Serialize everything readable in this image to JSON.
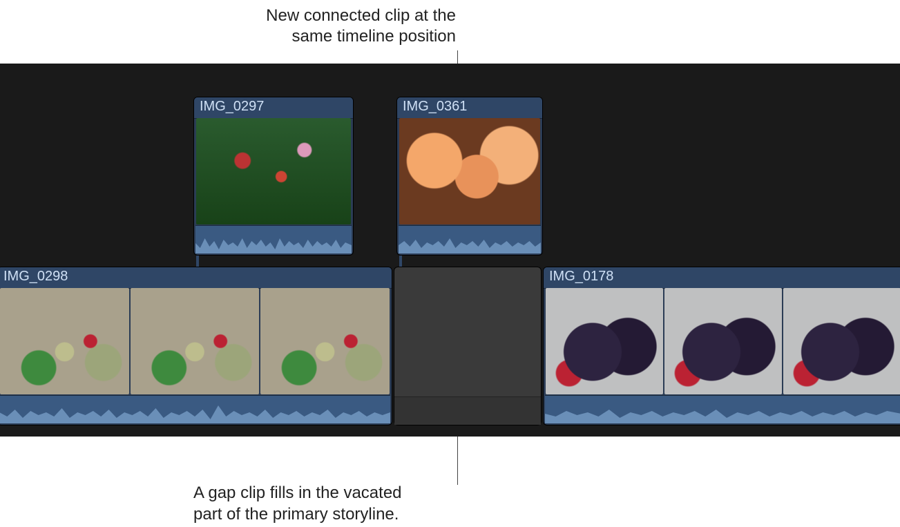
{
  "callouts": {
    "top_line1": "New connected clip at the",
    "top_line2": "same timeline position",
    "bottom_line1": "A gap clip fills in the vacated",
    "bottom_line2": "part of the primary storyline."
  },
  "clips": {
    "upper1_name": "IMG_0297",
    "upper2_name": "IMG_0361",
    "lower1_name": "IMG_0298",
    "lower2_name": "IMG_0178"
  }
}
